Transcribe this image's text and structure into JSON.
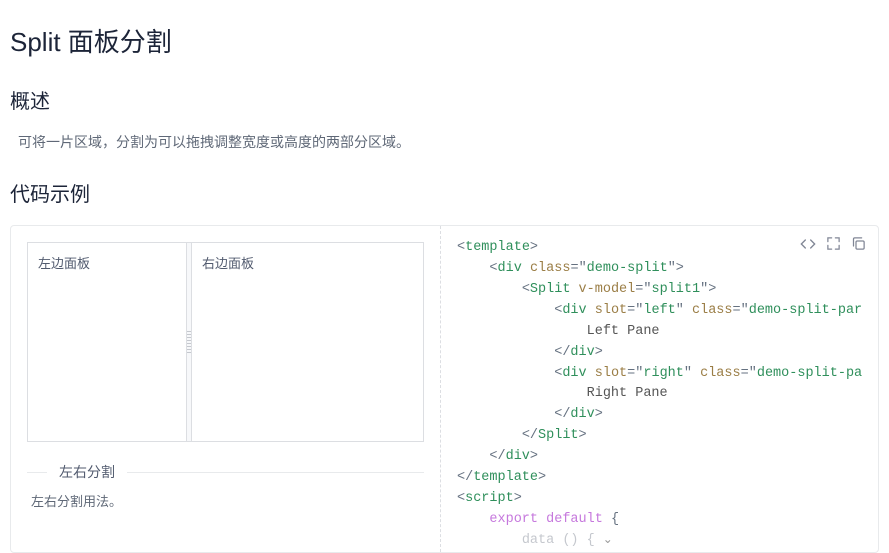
{
  "page": {
    "title": "Split 面板分割"
  },
  "sections": {
    "overview_heading": "概述",
    "overview_text": "可将一片区域，分割为可以拖拽调整宽度或高度的两部分区域。",
    "examples_heading": "代码示例"
  },
  "demo": {
    "left_pane_label": "左边面板",
    "right_pane_label": "右边面板",
    "title": "左右分割",
    "description": "左右分割用法。"
  },
  "code": {
    "l1_tag": "template",
    "l2_tag": "div",
    "l2_attr": "class",
    "l2_val": "demo-split",
    "l3_tag": "Split",
    "l3_attr": "v-model",
    "l3_val": "split1",
    "l4_tag": "div",
    "l4_attr1": "slot",
    "l4_val1": "left",
    "l4_attr2": "class",
    "l4_val2": "demo-split-par",
    "l5_text": "Left Pane",
    "l6_closetag": "div",
    "l7_tag": "div",
    "l7_attr1": "slot",
    "l7_val1": "right",
    "l7_attr2": "class",
    "l7_val2": "demo-split-pa",
    "l8_text": "Right Pane",
    "l9_closetag": "div",
    "l10_closetag": "Split",
    "l11_closetag": "div",
    "l12_closetag": "template",
    "l13_tag": "script",
    "l14a": "export",
    "l14b": "default",
    "l15_ghost": "data () {",
    "chev": "⌄"
  }
}
